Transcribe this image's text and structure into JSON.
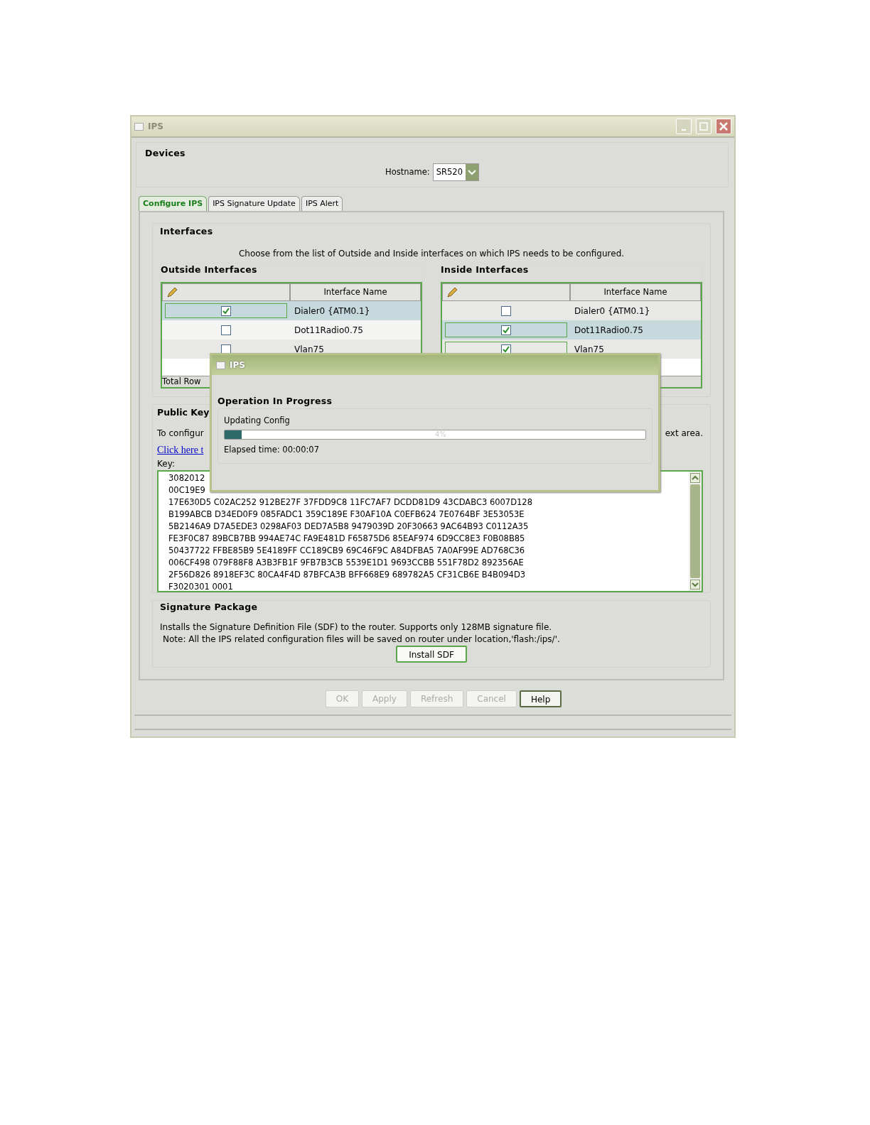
{
  "window": {
    "title": "IPS"
  },
  "devices": {
    "title": "Devices",
    "hostname_label": "Hostname:",
    "hostname_value": "SR520"
  },
  "tabs": [
    {
      "label": "Configure IPS",
      "selected": true
    },
    {
      "label": "IPS Signature Update",
      "selected": false
    },
    {
      "label": "IPS Alert",
      "selected": false
    }
  ],
  "interfaces": {
    "title": "Interfaces",
    "description": "Choose from the list of Outside and Inside interfaces on which IPS needs to be configured.",
    "outside": {
      "title": "Outside Interfaces",
      "column_2": "Interface Name",
      "footer": "Total Row",
      "rows": [
        {
          "checked": true,
          "name": "Dialer0 {ATM0.1}",
          "selected": true
        },
        {
          "checked": false,
          "name": "Dot11Radio0.75",
          "selected": false
        },
        {
          "checked": false,
          "name": "Vlan75",
          "selected": false
        }
      ]
    },
    "inside": {
      "title": "Inside Interfaces",
      "column_2": "Interface Name",
      "rows": [
        {
          "checked": false,
          "name": "Dialer0 {ATM0.1}",
          "selected": false
        },
        {
          "checked": true,
          "name": "Dot11Radio0.75",
          "selected": true
        },
        {
          "checked": true,
          "name": "Vlan75",
          "selected": false
        }
      ]
    }
  },
  "public_key": {
    "title": "Public Key",
    "instruction_start": "To configur",
    "instruction_end": "ext area.",
    "link": "Click here t",
    "key_label": "Key:",
    "key_lines": [
      "3082012",
      "00C19E9",
      "17E630D5 C02AC252 912BE27F 37FDD9C8 11FC7AF7 DCDD81D9 43CDABC3 6007D128",
      "B199ABCB D34ED0F9 085FADC1 359C189E F30AF10A C0EFB624 7E0764BF 3E53053E",
      "5B2146A9 D7A5EDE3 0298AF03 DED7A5B8 9479039D 20F30663 9AC64B93 C0112A35",
      "FE3F0C87 89BCB7BB 994AE74C FA9E481D F65875D6 85EAF974 6D9CC8E3 F0B08B85",
      "50437722 FFBE85B9 5E4189FF CC189CB9 69C46F9C A84DFBA5 7A0AF99E AD768C36",
      "006CF498 079F88F8 A3B3FB1F 9FB7B3CB 5539E1D1 9693CCBB 551F78D2 892356AE",
      "2F56D826 8918EF3C 80CA4F4D 87BFCA3B BFF668E9 689782A5 CF31CB6E B4B094D3",
      "F3020301 0001"
    ]
  },
  "signature_package": {
    "title": "Signature Package",
    "lines": [
      "Installs the Signature Definition File (SDF) to the router. Supports only 128MB signature file.",
      "Note: All the IPS related configuration files will be saved on router under location,'flash:/ips/'."
    ],
    "button": "Install SDF"
  },
  "buttons": [
    {
      "label": "OK",
      "disabled": true
    },
    {
      "label": "Apply",
      "disabled": true
    },
    {
      "label": "Refresh",
      "disabled": true
    },
    {
      "label": "Cancel",
      "disabled": true
    },
    {
      "label": "Help",
      "disabled": false
    }
  ],
  "dialog": {
    "title": "IPS",
    "heading": "Operation In Progress",
    "status": "Updating Config",
    "level": 0.04,
    "percent": "4%",
    "elapsed": "Elapsed time: 00:00:07"
  }
}
